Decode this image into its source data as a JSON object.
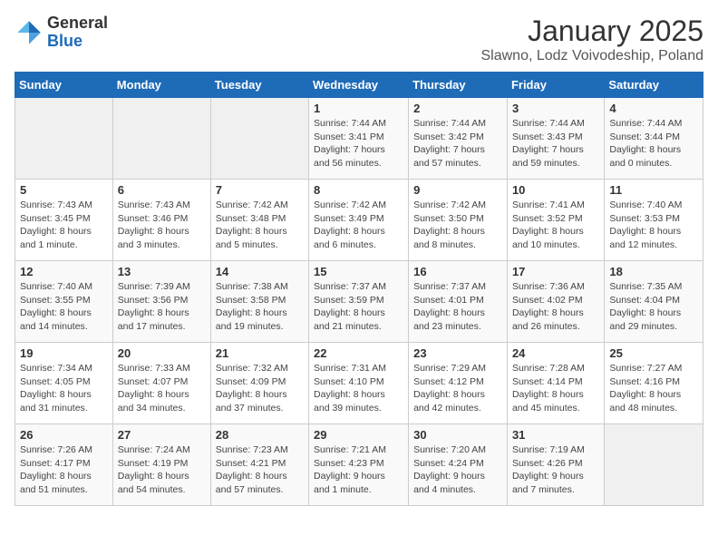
{
  "logo": {
    "general": "General",
    "blue": "Blue"
  },
  "title": "January 2025",
  "subtitle": "Slawno, Lodz Voivodeship, Poland",
  "weekdays": [
    "Sunday",
    "Monday",
    "Tuesday",
    "Wednesday",
    "Thursday",
    "Friday",
    "Saturday"
  ],
  "weeks": [
    [
      {
        "day": "",
        "info": ""
      },
      {
        "day": "",
        "info": ""
      },
      {
        "day": "",
        "info": ""
      },
      {
        "day": "1",
        "info": "Sunrise: 7:44 AM\nSunset: 3:41 PM\nDaylight: 7 hours\nand 56 minutes."
      },
      {
        "day": "2",
        "info": "Sunrise: 7:44 AM\nSunset: 3:42 PM\nDaylight: 7 hours\nand 57 minutes."
      },
      {
        "day": "3",
        "info": "Sunrise: 7:44 AM\nSunset: 3:43 PM\nDaylight: 7 hours\nand 59 minutes."
      },
      {
        "day": "4",
        "info": "Sunrise: 7:44 AM\nSunset: 3:44 PM\nDaylight: 8 hours\nand 0 minutes."
      }
    ],
    [
      {
        "day": "5",
        "info": "Sunrise: 7:43 AM\nSunset: 3:45 PM\nDaylight: 8 hours\nand 1 minute."
      },
      {
        "day": "6",
        "info": "Sunrise: 7:43 AM\nSunset: 3:46 PM\nDaylight: 8 hours\nand 3 minutes."
      },
      {
        "day": "7",
        "info": "Sunrise: 7:42 AM\nSunset: 3:48 PM\nDaylight: 8 hours\nand 5 minutes."
      },
      {
        "day": "8",
        "info": "Sunrise: 7:42 AM\nSunset: 3:49 PM\nDaylight: 8 hours\nand 6 minutes."
      },
      {
        "day": "9",
        "info": "Sunrise: 7:42 AM\nSunset: 3:50 PM\nDaylight: 8 hours\nand 8 minutes."
      },
      {
        "day": "10",
        "info": "Sunrise: 7:41 AM\nSunset: 3:52 PM\nDaylight: 8 hours\nand 10 minutes."
      },
      {
        "day": "11",
        "info": "Sunrise: 7:40 AM\nSunset: 3:53 PM\nDaylight: 8 hours\nand 12 minutes."
      }
    ],
    [
      {
        "day": "12",
        "info": "Sunrise: 7:40 AM\nSunset: 3:55 PM\nDaylight: 8 hours\nand 14 minutes."
      },
      {
        "day": "13",
        "info": "Sunrise: 7:39 AM\nSunset: 3:56 PM\nDaylight: 8 hours\nand 17 minutes."
      },
      {
        "day": "14",
        "info": "Sunrise: 7:38 AM\nSunset: 3:58 PM\nDaylight: 8 hours\nand 19 minutes."
      },
      {
        "day": "15",
        "info": "Sunrise: 7:37 AM\nSunset: 3:59 PM\nDaylight: 8 hours\nand 21 minutes."
      },
      {
        "day": "16",
        "info": "Sunrise: 7:37 AM\nSunset: 4:01 PM\nDaylight: 8 hours\nand 23 minutes."
      },
      {
        "day": "17",
        "info": "Sunrise: 7:36 AM\nSunset: 4:02 PM\nDaylight: 8 hours\nand 26 minutes."
      },
      {
        "day": "18",
        "info": "Sunrise: 7:35 AM\nSunset: 4:04 PM\nDaylight: 8 hours\nand 29 minutes."
      }
    ],
    [
      {
        "day": "19",
        "info": "Sunrise: 7:34 AM\nSunset: 4:05 PM\nDaylight: 8 hours\nand 31 minutes."
      },
      {
        "day": "20",
        "info": "Sunrise: 7:33 AM\nSunset: 4:07 PM\nDaylight: 8 hours\nand 34 minutes."
      },
      {
        "day": "21",
        "info": "Sunrise: 7:32 AM\nSunset: 4:09 PM\nDaylight: 8 hours\nand 37 minutes."
      },
      {
        "day": "22",
        "info": "Sunrise: 7:31 AM\nSunset: 4:10 PM\nDaylight: 8 hours\nand 39 minutes."
      },
      {
        "day": "23",
        "info": "Sunrise: 7:29 AM\nSunset: 4:12 PM\nDaylight: 8 hours\nand 42 minutes."
      },
      {
        "day": "24",
        "info": "Sunrise: 7:28 AM\nSunset: 4:14 PM\nDaylight: 8 hours\nand 45 minutes."
      },
      {
        "day": "25",
        "info": "Sunrise: 7:27 AM\nSunset: 4:16 PM\nDaylight: 8 hours\nand 48 minutes."
      }
    ],
    [
      {
        "day": "26",
        "info": "Sunrise: 7:26 AM\nSunset: 4:17 PM\nDaylight: 8 hours\nand 51 minutes."
      },
      {
        "day": "27",
        "info": "Sunrise: 7:24 AM\nSunset: 4:19 PM\nDaylight: 8 hours\nand 54 minutes."
      },
      {
        "day": "28",
        "info": "Sunrise: 7:23 AM\nSunset: 4:21 PM\nDaylight: 8 hours\nand 57 minutes."
      },
      {
        "day": "29",
        "info": "Sunrise: 7:21 AM\nSunset: 4:23 PM\nDaylight: 9 hours\nand 1 minute."
      },
      {
        "day": "30",
        "info": "Sunrise: 7:20 AM\nSunset: 4:24 PM\nDaylight: 9 hours\nand 4 minutes."
      },
      {
        "day": "31",
        "info": "Sunrise: 7:19 AM\nSunset: 4:26 PM\nDaylight: 9 hours\nand 7 minutes."
      },
      {
        "day": "",
        "info": ""
      }
    ]
  ]
}
